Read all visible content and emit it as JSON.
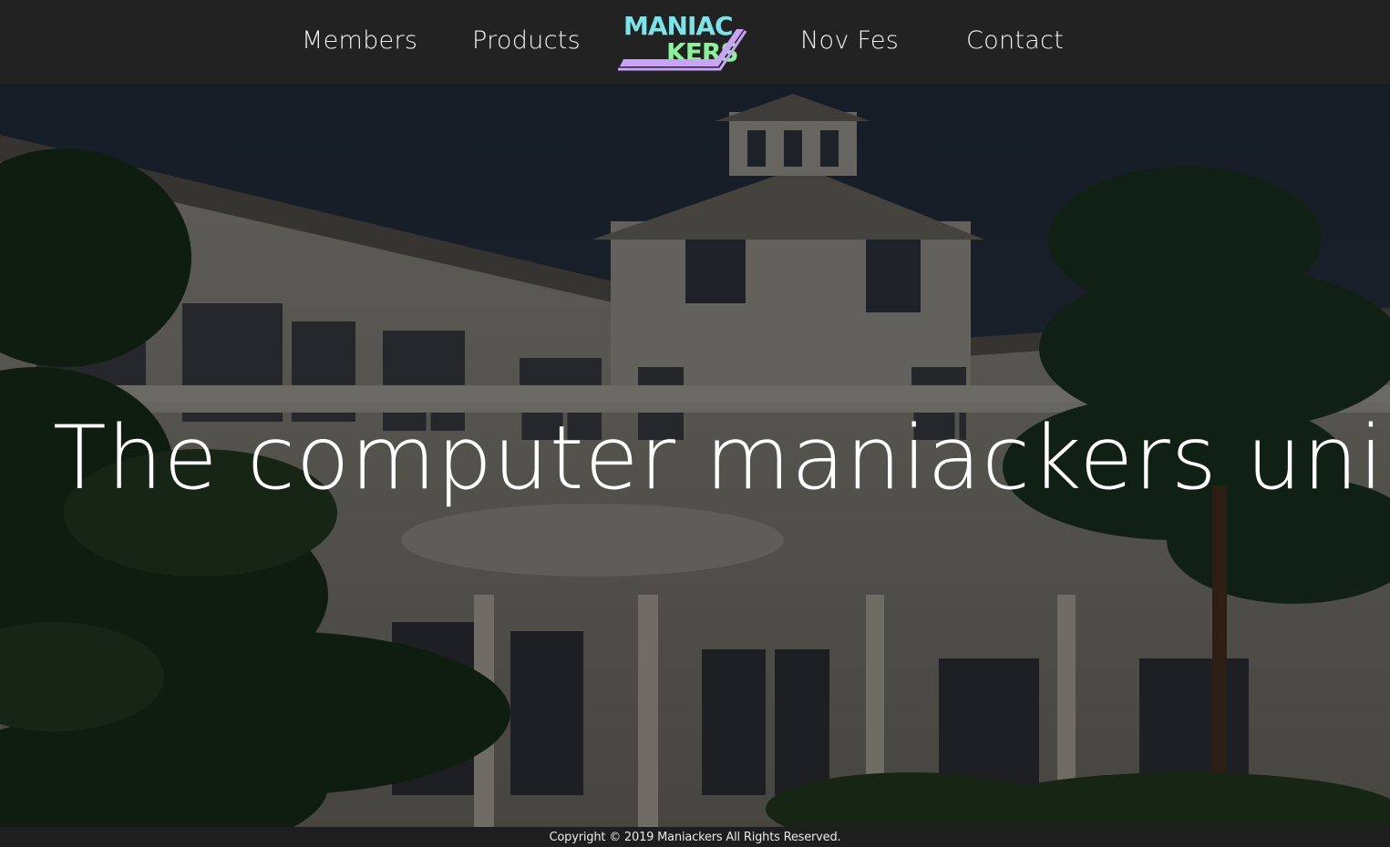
{
  "nav": {
    "members": "Members",
    "products": "Products",
    "nov_fes": "Nov Fes",
    "contact": "Contact"
  },
  "logo": {
    "line1": "MANIAC",
    "line2": "KERS"
  },
  "hero": {
    "title": "The computer maniackers union."
  },
  "footer": {
    "copyright": "Copyright © 2019 Maniackers All Rights Reserved."
  },
  "colors": {
    "header_bg": "#222222",
    "logo_cyan": "#7de3e8",
    "logo_green": "#8df09a",
    "logo_pink": "#f29ad3",
    "logo_purple": "#c9a3f5",
    "text": "#ffffff"
  }
}
